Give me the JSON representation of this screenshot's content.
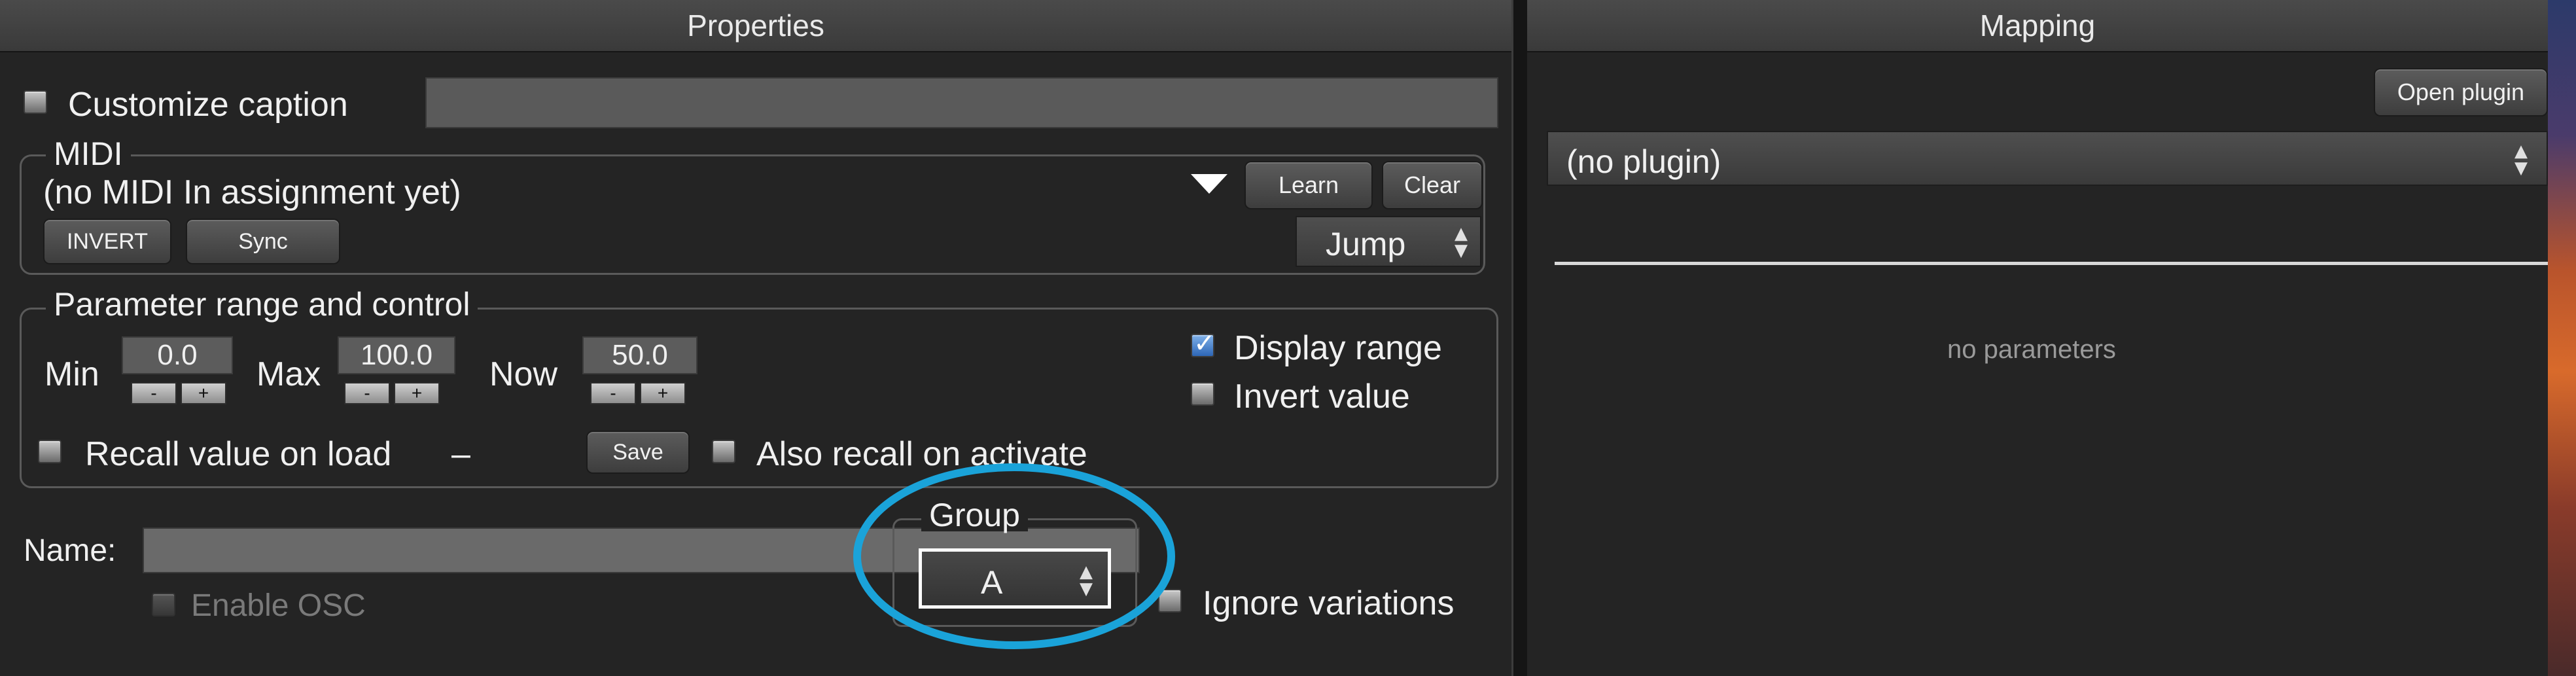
{
  "properties": {
    "title": "Properties",
    "customize_caption": {
      "label": "Customize caption",
      "checked": false,
      "value": ""
    },
    "midi": {
      "legend": "MIDI",
      "status": "(no MIDI In assignment yet)",
      "invert_label": "INVERT",
      "sync_label": "Sync",
      "learn_label": "Learn",
      "clear_label": "Clear",
      "mode_value": "Jump"
    },
    "range": {
      "legend": "Parameter range and control",
      "min_label": "Min",
      "min_value": "0.0",
      "max_label": "Max",
      "max_value": "100.0",
      "now_label": "Now",
      "now_value": "50.0",
      "minus": "-",
      "plus": "+",
      "display_range_label": "Display range",
      "display_range_checked": true,
      "invert_value_label": "Invert value",
      "invert_value_checked": false,
      "recall_label": "Recall value on load",
      "recall_checked": false,
      "recall_value": "–",
      "save_label": "Save",
      "also_recall_label": "Also recall on activate",
      "also_recall_checked": false
    },
    "name": {
      "label": "Name:",
      "value": ""
    },
    "enable_osc": {
      "label": "Enable OSC",
      "checked": false
    },
    "group": {
      "legend": "Group",
      "value": "A"
    },
    "ignore_variations": {
      "label": "Ignore variations",
      "checked": false
    }
  },
  "mapping": {
    "title": "Mapping",
    "open_plugin_label": "Open plugin",
    "plugin_value": "(no plugin)",
    "empty_text": "no parameters"
  },
  "annotation_color": "#1aa3d9"
}
